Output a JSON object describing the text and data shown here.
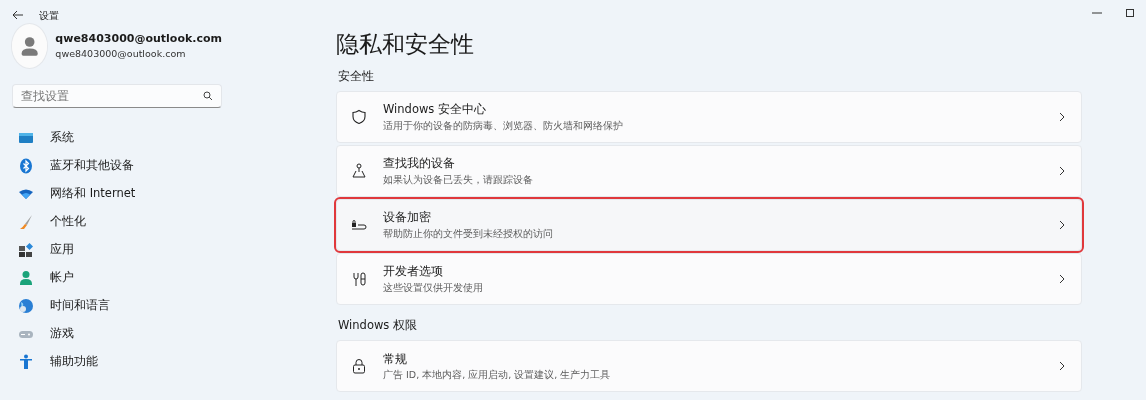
{
  "window": {
    "title": "设置"
  },
  "account": {
    "name": "qwe8403000@outlook.com",
    "email": "qwe8403000@outlook.com"
  },
  "search": {
    "placeholder": "查找设置"
  },
  "sidebar": {
    "items": [
      {
        "label": "系统",
        "kind": "system"
      },
      {
        "label": "蓝牙和其他设备",
        "kind": "bluetooth"
      },
      {
        "label": "网络和 Internet",
        "kind": "wifi"
      },
      {
        "label": "个性化",
        "kind": "brush"
      },
      {
        "label": "应用",
        "kind": "apps"
      },
      {
        "label": "帐户",
        "kind": "account"
      },
      {
        "label": "时间和语言",
        "kind": "globe"
      },
      {
        "label": "游戏",
        "kind": "gamepad"
      },
      {
        "label": "辅助功能",
        "kind": "accessibility"
      }
    ]
  },
  "page": {
    "title": "隐私和安全性",
    "sections": [
      {
        "heading": "安全性",
        "items": [
          {
            "title": "Windows 安全中心",
            "subtitle": "适用于你的设备的防病毒、浏览器、防火墙和网络保护",
            "kind": "shield",
            "highlighted": false
          },
          {
            "title": "查找我的设备",
            "subtitle": "如果认为设备已丢失，请跟踪设备",
            "kind": "locate",
            "highlighted": false
          },
          {
            "title": "设备加密",
            "subtitle": "帮助防止你的文件受到未经授权的访问",
            "kind": "drive-lock",
            "highlighted": true
          },
          {
            "title": "开发者选项",
            "subtitle": "这些设置仅供开发使用",
            "kind": "tools",
            "highlighted": false
          }
        ]
      },
      {
        "heading": "Windows 权限",
        "items": [
          {
            "title": "常规",
            "subtitle": "广告 ID, 本地内容, 应用启动, 设置建议, 生产力工具",
            "kind": "lock",
            "highlighted": false
          }
        ]
      }
    ]
  }
}
